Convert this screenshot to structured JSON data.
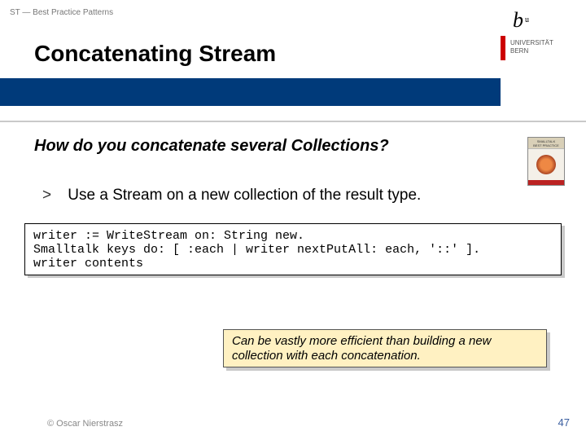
{
  "header": {
    "label": "ST — Best Practice Patterns",
    "title": "Concatenating Stream"
  },
  "logo": {
    "letter": "b",
    "super": "u",
    "line1": "UNIVERSITÄT",
    "line2": "BERN"
  },
  "book": {
    "title1": "SMALLTALK",
    "title2": "BEST PRACTICE",
    "title3": "PATTERNS"
  },
  "question": "How do you concatenate several Collections?",
  "bullet": {
    "marker": ">",
    "text": "Use a Stream on a new collection of the result type."
  },
  "code": {
    "line1": "writer := WriteStream on: String new.",
    "line2": "Smalltalk keys do: [ :each | writer nextPutAll: each, '::' ].",
    "line3": "writer contents"
  },
  "note": "Can be vastly more efficient than building a new collection with each concatenation.",
  "footer": {
    "copyright": "© Oscar Nierstrasz",
    "page": "47"
  }
}
